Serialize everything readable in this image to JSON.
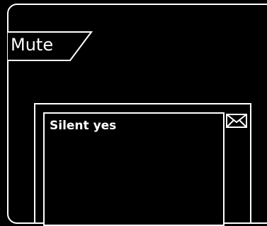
{
  "tab": {
    "label": "Mute"
  },
  "message": {
    "text": "Silent yes",
    "icon": "envelope-icon"
  },
  "colors": {
    "background": "#000000",
    "foreground": "#ffffff"
  }
}
